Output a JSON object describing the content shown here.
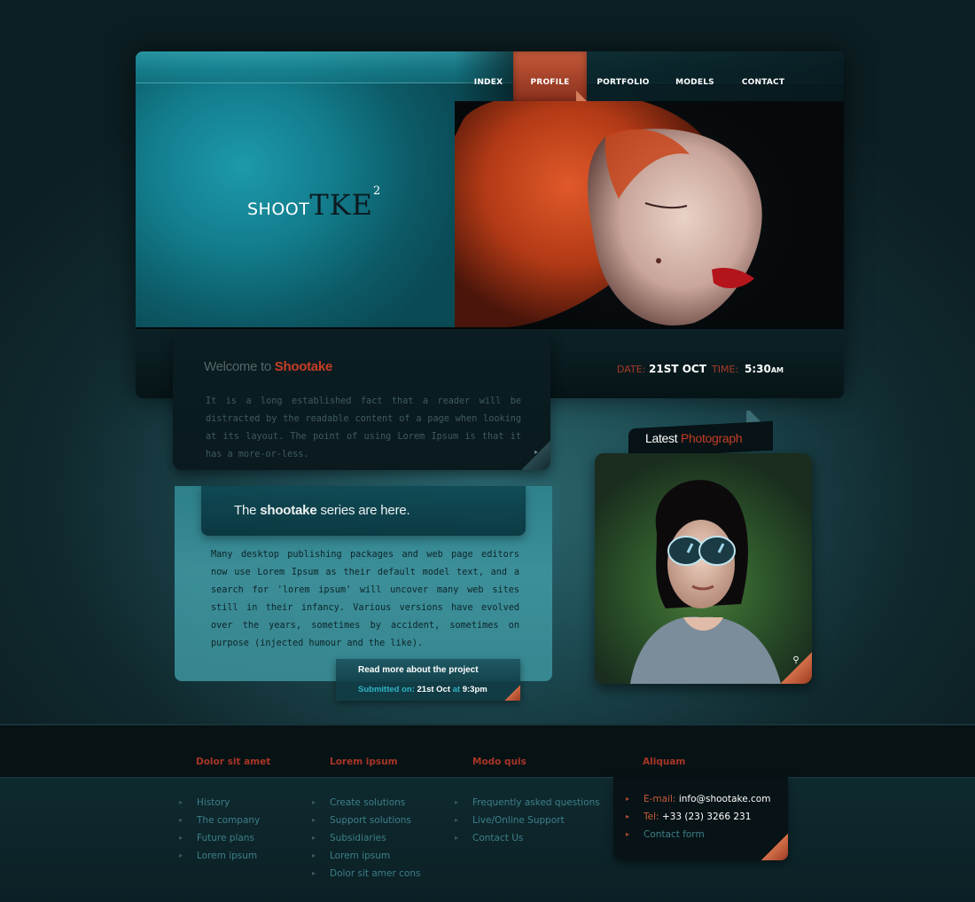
{
  "nav": {
    "items": [
      {
        "label": "INDEX"
      },
      {
        "label": "PROFILE",
        "active": true
      },
      {
        "label": "PORTFOLIO"
      },
      {
        "label": "MODELS"
      },
      {
        "label": "CONTACT"
      }
    ]
  },
  "logo": {
    "small": "SHOOT",
    "big": "TKE",
    "sup": "2"
  },
  "header_info": {
    "date_label": "DATE:",
    "date_value": "21ST OCT",
    "time_label": "TIME:",
    "time_value": "5:30",
    "time_suffix": "AM"
  },
  "welcome": {
    "title_prefix": "Welcome to ",
    "title_brand": "Shootake",
    "text": "It is a long established fact that a reader will be distracted by the readable content of a page when looking at its layout. The point of using Lorem Ipsum is that it has a more-or-less."
  },
  "series": {
    "title_pre": "The ",
    "title_bold": "shootake",
    "title_post": " series are here.",
    "text": "Many desktop publishing packages and web page editors now use Lorem Ipsum as their default model text, and a search for 'lorem ipsum' will uncover many web sites still in their infancy. Various versions have evolved over the years, sometimes by accident, sometimes on purpose (injected humour and the like).",
    "readmore": "Read more about the project",
    "submitted_label": "Submitted on:",
    "submitted_date": "21st Oct",
    "submitted_at": "at",
    "submitted_time": "9:3pm"
  },
  "latest": {
    "title_pre": "Latest ",
    "title_accent": "Photograph"
  },
  "footer": {
    "columns": [
      {
        "title": "Dolor sit amet",
        "items": [
          "History",
          "The company",
          "Future plans",
          "Lorem ipsum"
        ]
      },
      {
        "title": "Lorem ipsum",
        "items": [
          "Create solutions",
          "Support solutions",
          "Subsidiaries",
          "Lorem ipsum",
          "Dolor sit amer cons"
        ]
      },
      {
        "title": "Modo quis",
        "items": [
          "Frequently asked questions",
          "Live/Online Support",
          "Contact Us"
        ]
      }
    ],
    "contact": {
      "title": "Aliquam",
      "email_label": "E-mail:",
      "email": "info@shootake.com",
      "tel_label": "Tel:",
      "tel": "+33 (23) 3266 231",
      "form": "Contact form"
    }
  }
}
